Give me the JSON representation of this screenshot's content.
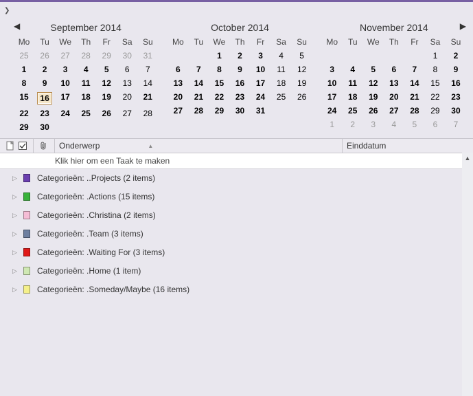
{
  "months": [
    {
      "title": "September 2014",
      "showPrev": true,
      "showNext": false,
      "weeks": [
        [
          {
            "n": "25",
            "m": true
          },
          {
            "n": "26",
            "m": true
          },
          {
            "n": "27",
            "m": true
          },
          {
            "n": "28",
            "m": true
          },
          {
            "n": "29",
            "m": true
          },
          {
            "n": "30",
            "m": true
          },
          {
            "n": "31",
            "m": true
          }
        ],
        [
          {
            "n": "1",
            "b": true
          },
          {
            "n": "2",
            "b": true
          },
          {
            "n": "3",
            "b": true
          },
          {
            "n": "4",
            "b": true
          },
          {
            "n": "5",
            "b": true
          },
          {
            "n": "6"
          },
          {
            "n": "7"
          }
        ],
        [
          {
            "n": "8",
            "b": true
          },
          {
            "n": "9",
            "b": true
          },
          {
            "n": "10",
            "b": true
          },
          {
            "n": "11",
            "b": true
          },
          {
            "n": "12",
            "b": true
          },
          {
            "n": "13"
          },
          {
            "n": "14"
          }
        ],
        [
          {
            "n": "15",
            "b": true
          },
          {
            "n": "16",
            "b": true,
            "today": true
          },
          {
            "n": "17",
            "b": true
          },
          {
            "n": "18",
            "b": true
          },
          {
            "n": "19",
            "b": true
          },
          {
            "n": "20"
          },
          {
            "n": "21",
            "b": true
          }
        ],
        [
          {
            "n": "22",
            "b": true
          },
          {
            "n": "23",
            "b": true
          },
          {
            "n": "24",
            "b": true
          },
          {
            "n": "25",
            "b": true
          },
          {
            "n": "26",
            "b": true
          },
          {
            "n": "27"
          },
          {
            "n": "28"
          }
        ],
        [
          {
            "n": "29",
            "b": true
          },
          {
            "n": "30",
            "b": true
          },
          {
            "n": ""
          },
          {
            "n": ""
          },
          {
            "n": ""
          },
          {
            "n": ""
          },
          {
            "n": ""
          }
        ]
      ]
    },
    {
      "title": "October 2014",
      "showPrev": false,
      "showNext": false,
      "weeks": [
        [
          {
            "n": ""
          },
          {
            "n": ""
          },
          {
            "n": "1",
            "b": true
          },
          {
            "n": "2",
            "b": true
          },
          {
            "n": "3",
            "b": true
          },
          {
            "n": "4"
          },
          {
            "n": "5"
          }
        ],
        [
          {
            "n": "6",
            "b": true
          },
          {
            "n": "7",
            "b": true
          },
          {
            "n": "8",
            "b": true
          },
          {
            "n": "9",
            "b": true
          },
          {
            "n": "10",
            "b": true
          },
          {
            "n": "11"
          },
          {
            "n": "12"
          }
        ],
        [
          {
            "n": "13",
            "b": true
          },
          {
            "n": "14",
            "b": true
          },
          {
            "n": "15",
            "b": true
          },
          {
            "n": "16",
            "b": true
          },
          {
            "n": "17",
            "b": true
          },
          {
            "n": "18"
          },
          {
            "n": "19"
          }
        ],
        [
          {
            "n": "20",
            "b": true
          },
          {
            "n": "21",
            "b": true
          },
          {
            "n": "22",
            "b": true
          },
          {
            "n": "23",
            "b": true
          },
          {
            "n": "24",
            "b": true
          },
          {
            "n": "25"
          },
          {
            "n": "26"
          }
        ],
        [
          {
            "n": "27",
            "b": true
          },
          {
            "n": "28",
            "b": true
          },
          {
            "n": "29",
            "b": true
          },
          {
            "n": "30",
            "b": true
          },
          {
            "n": "31",
            "b": true
          },
          {
            "n": ""
          },
          {
            "n": ""
          }
        ]
      ]
    },
    {
      "title": "November 2014",
      "showPrev": false,
      "showNext": true,
      "weeks": [
        [
          {
            "n": ""
          },
          {
            "n": ""
          },
          {
            "n": ""
          },
          {
            "n": ""
          },
          {
            "n": ""
          },
          {
            "n": "1"
          },
          {
            "n": "2",
            "b": true
          }
        ],
        [
          {
            "n": "3",
            "b": true
          },
          {
            "n": "4",
            "b": true
          },
          {
            "n": "5",
            "b": true
          },
          {
            "n": "6",
            "b": true
          },
          {
            "n": "7",
            "b": true
          },
          {
            "n": "8"
          },
          {
            "n": "9",
            "b": true
          }
        ],
        [
          {
            "n": "10",
            "b": true
          },
          {
            "n": "11",
            "b": true
          },
          {
            "n": "12",
            "b": true
          },
          {
            "n": "13",
            "b": true
          },
          {
            "n": "14",
            "b": true
          },
          {
            "n": "15"
          },
          {
            "n": "16",
            "b": true
          }
        ],
        [
          {
            "n": "17",
            "b": true
          },
          {
            "n": "18",
            "b": true
          },
          {
            "n": "19",
            "b": true
          },
          {
            "n": "20",
            "b": true
          },
          {
            "n": "21",
            "b": true
          },
          {
            "n": "22"
          },
          {
            "n": "23",
            "b": true
          }
        ],
        [
          {
            "n": "24",
            "b": true
          },
          {
            "n": "25",
            "b": true
          },
          {
            "n": "26",
            "b": true
          },
          {
            "n": "27",
            "b": true
          },
          {
            "n": "28",
            "b": true
          },
          {
            "n": "29"
          },
          {
            "n": "30",
            "b": true
          }
        ],
        [
          {
            "n": "1",
            "m": true
          },
          {
            "n": "2",
            "m": true
          },
          {
            "n": "3",
            "m": true
          },
          {
            "n": "4",
            "m": true
          },
          {
            "n": "5",
            "m": true
          },
          {
            "n": "6",
            "m": true
          },
          {
            "n": "7",
            "m": true
          }
        ]
      ]
    }
  ],
  "dow": [
    "Mo",
    "Tu",
    "We",
    "Th",
    "Fr",
    "Sa",
    "Su"
  ],
  "columns": {
    "subject": "Onderwerp",
    "dueDate": "Einddatum"
  },
  "newTaskPlaceholder": "Klik hier om een Taak te maken",
  "groups": [
    {
      "color": "#6b3fb0",
      "label": "Categorieën: ..Projects (2 items)"
    },
    {
      "color": "#38b23a",
      "label": "Categorieën: .Actions (15 items)"
    },
    {
      "color": "#f5bdd6",
      "label": "Categorieën: .Christina (2 items)"
    },
    {
      "color": "#6e7fa0",
      "label": "Categorieën: .Team (3 items)"
    },
    {
      "color": "#e01919",
      "label": "Categorieën: .Waiting For (3 items)"
    },
    {
      "color": "#cfe8b3",
      "label": "Categorieën: .Home (1 item)"
    },
    {
      "color": "#f5f08a",
      "label": "Categorieën: .Someday/Maybe (16 items)"
    }
  ]
}
